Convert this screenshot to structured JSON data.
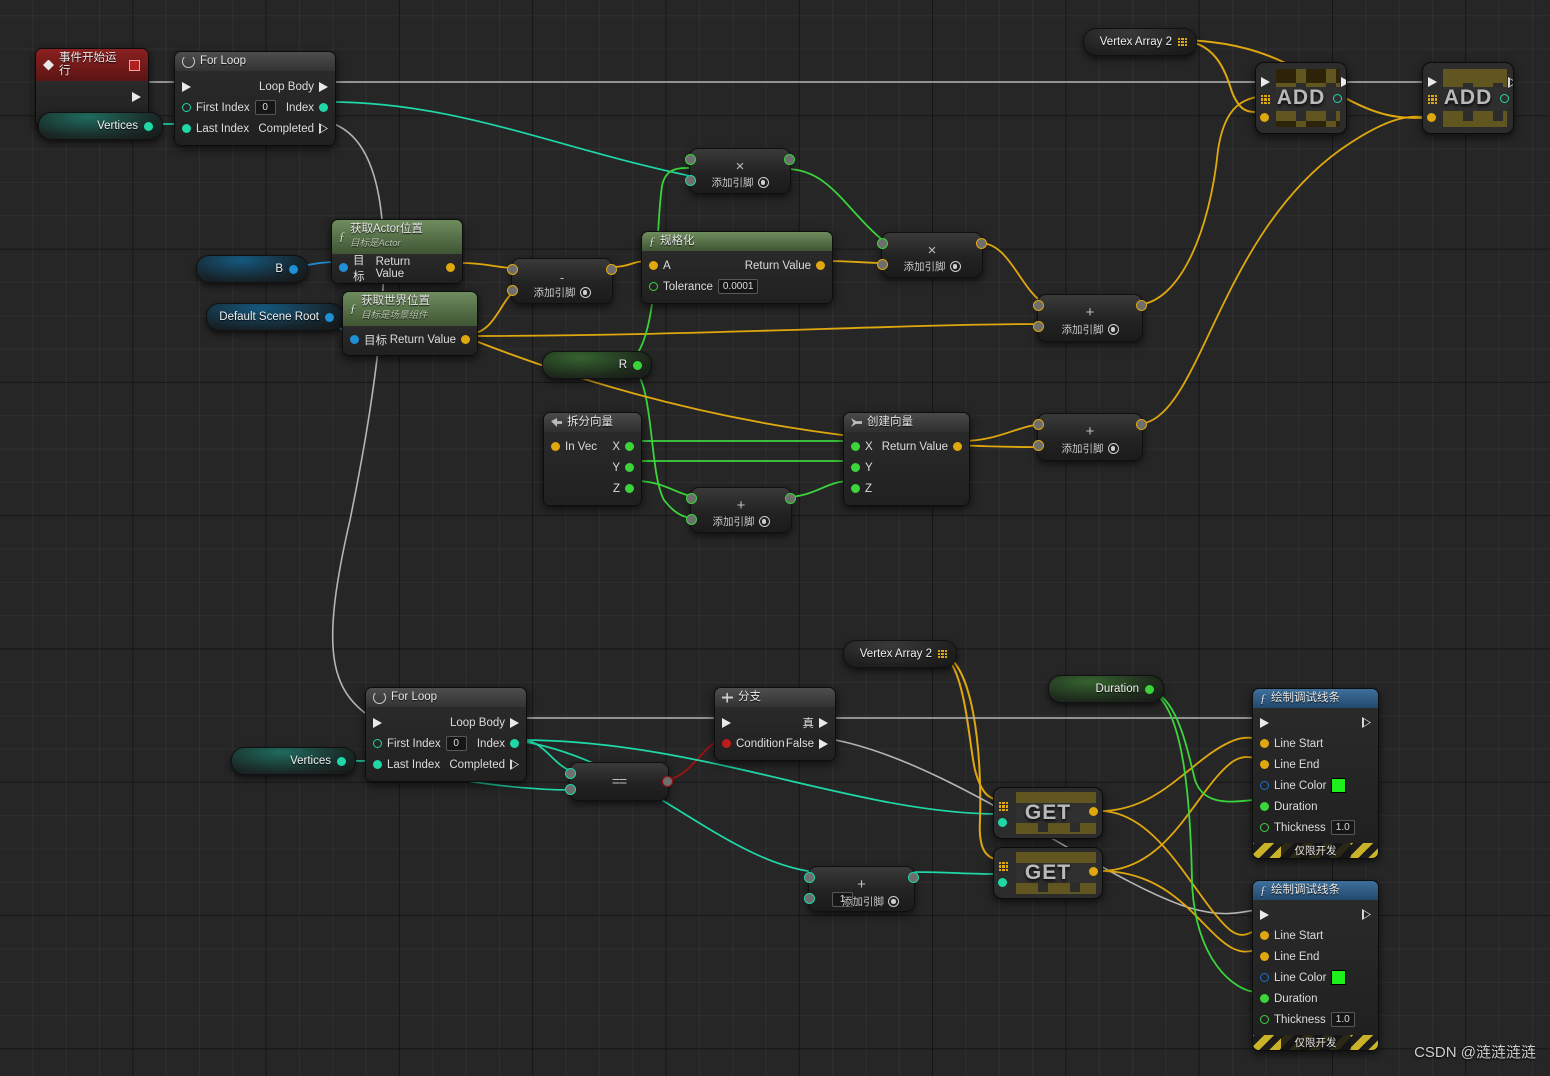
{
  "app": {
    "kind": "unreal-blueprint-graph",
    "watermark": "CSDN @涟涟涟涟"
  },
  "nodes": {
    "event_begin": {
      "title": "事件开始运行",
      "exec_out": "",
      "type": "event"
    },
    "for_loop_1": {
      "title": "For Loop",
      "rows": {
        "first_index": "First Index",
        "first_index_value": "0",
        "last_index": "Last Index",
        "loop_body": "Loop Body",
        "index": "Index",
        "completed": "Completed"
      }
    },
    "vertices_1": {
      "label": "Vertices"
    },
    "vertices_2": {
      "label": "Vertices"
    },
    "b_var": {
      "label": "B"
    },
    "default_scene_root": {
      "label": "Default Scene Root"
    },
    "get_actor_location": {
      "title": "获取Actor位置",
      "subtitle": "目标是Actor",
      "target": "目标",
      "return_value": "Return Value"
    },
    "get_world_location": {
      "title": "获取世界位置",
      "subtitle": "目标是场景组件",
      "target": "目标",
      "return_value": "Return Value"
    },
    "subtract": {
      "op": "-",
      "add_pin": "添加引脚"
    },
    "multiply_top": {
      "op": "×",
      "add_pin": "添加引脚"
    },
    "multiply_mid": {
      "op": "×",
      "add_pin": "添加引脚"
    },
    "normalize": {
      "title": "规格化",
      "a": "A",
      "tolerance": "Tolerance",
      "tolerance_value": "0.0001",
      "return_value": "Return Value"
    },
    "r_var": {
      "label": "R"
    },
    "break_vector": {
      "title": "拆分向量",
      "in_vec": "In Vec",
      "x": "X",
      "y": "Y",
      "z": "Z"
    },
    "make_vector": {
      "title": "创建向量",
      "x": "X",
      "y": "Y",
      "z": "Z",
      "return_value": "Return Value"
    },
    "add_z": {
      "op": "+",
      "add_pin": "添加引脚"
    },
    "add_r1": {
      "op": "+",
      "add_pin": "添加引脚"
    },
    "add_r2": {
      "op": "+",
      "add_pin": "添加引脚"
    },
    "vertex_array_2_top": {
      "label": "Vertex Array 2"
    },
    "vertex_array_2_bottom": {
      "label": "Vertex Array 2"
    },
    "array_add_1": {
      "label": "ADD"
    },
    "array_add_2": {
      "label": "ADD"
    },
    "for_loop_2": {
      "title": "For Loop",
      "rows": {
        "first_index": "First Index",
        "first_index_value": "0",
        "last_index": "Last Index",
        "loop_body": "Loop Body",
        "index": "Index",
        "completed": "Completed"
      }
    },
    "equal": {
      "op": "=="
    },
    "branch": {
      "title": "分支",
      "condition": "Condition",
      "true": "真",
      "false": "False"
    },
    "add_one": {
      "op": "+",
      "add_pin": "添加引脚",
      "value": "1"
    },
    "array_get_1": {
      "label": "GET"
    },
    "array_get_2": {
      "label": "GET"
    },
    "duration_var": {
      "label": "Duration"
    },
    "draw_debug_line_1": {
      "title": "绘制调试线条",
      "line_start": "Line Start",
      "line_end": "Line End",
      "line_color": "Line Color",
      "line_color_value": "#1EF01E",
      "duration": "Duration",
      "thickness": "Thickness",
      "thickness_value": "1.0",
      "footer": "仅限开发"
    },
    "draw_debug_line_2": {
      "title": "绘制调试线条",
      "line_start": "Line Start",
      "line_end": "Line End",
      "line_color": "Line Color",
      "line_color_value": "#1EF01E",
      "duration": "Duration",
      "thickness": "Thickness",
      "thickness_value": "1.0",
      "footer": "仅限开发"
    }
  },
  "colors": {
    "exec_wire": "#b5b5b5",
    "vector_wire": "#e0a80f",
    "float_wire": "#3bd43b",
    "int_wire": "#1fd8a8",
    "bool_wire": "#9e1212",
    "object_wire": "#1f8fd6",
    "function_header": "#4d6b3f",
    "event_header": "#7e1a1a",
    "flow_header": "#3a3a3a",
    "debug_header": "#2b5478",
    "array_gold": "#d8a512"
  }
}
